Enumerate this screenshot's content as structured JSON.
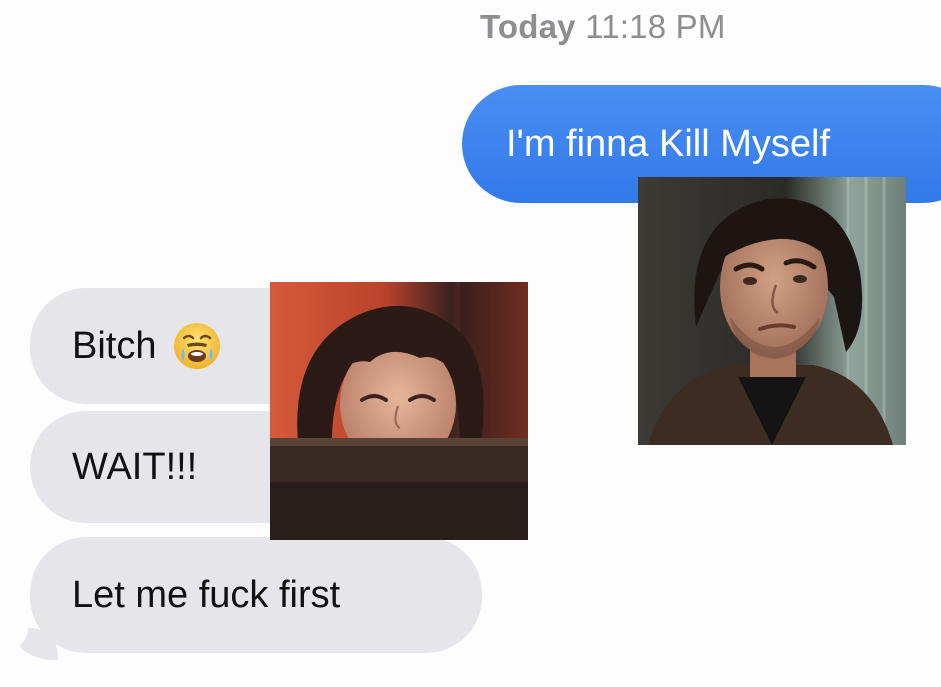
{
  "conversation": {
    "timestamp": {
      "day": "Today",
      "time": "11:18 PM"
    },
    "messages": [
      {
        "direction": "outgoing",
        "text": "I'm finna Kill Myself"
      },
      {
        "direction": "incoming",
        "text": "Bitch",
        "emoji": "crying-face-emoji"
      },
      {
        "direction": "incoming",
        "text": "WAIT!!!"
      },
      {
        "direction": "incoming",
        "text": "Let me fuck first"
      }
    ]
  },
  "colors": {
    "outgoing_bubble": "#3b82f6",
    "incoming_bubble": "#e6e6ea",
    "timestamp_text": "#8d8d92"
  },
  "overlay_images": [
    {
      "subject": "smiling woman with dark bob haircut"
    },
    {
      "subject": "man with dark hair and skeptical expression"
    }
  ]
}
